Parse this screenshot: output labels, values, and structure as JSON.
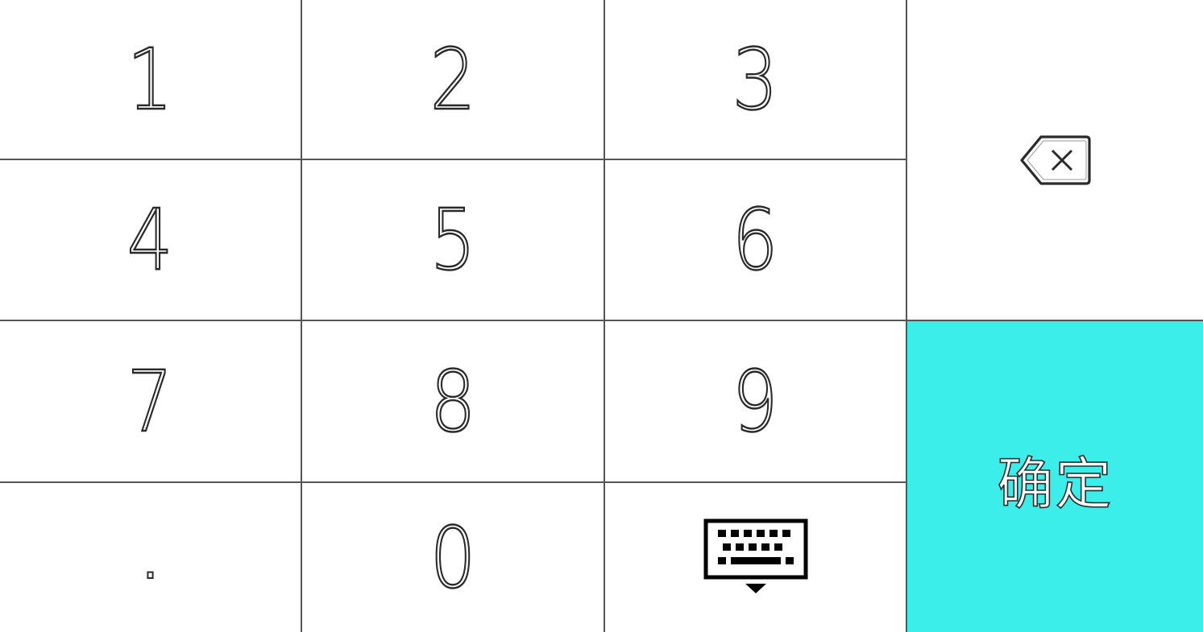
{
  "keypad": {
    "keys": [
      "1",
      "2",
      "3",
      "4",
      "5",
      "6",
      "7",
      "8",
      "9",
      ".",
      "0"
    ],
    "confirm_label": "确定",
    "accent_color": "#3ceeea",
    "icons": {
      "backspace": "backspace-icon",
      "hide_keyboard": "keyboard-hide-icon"
    }
  }
}
